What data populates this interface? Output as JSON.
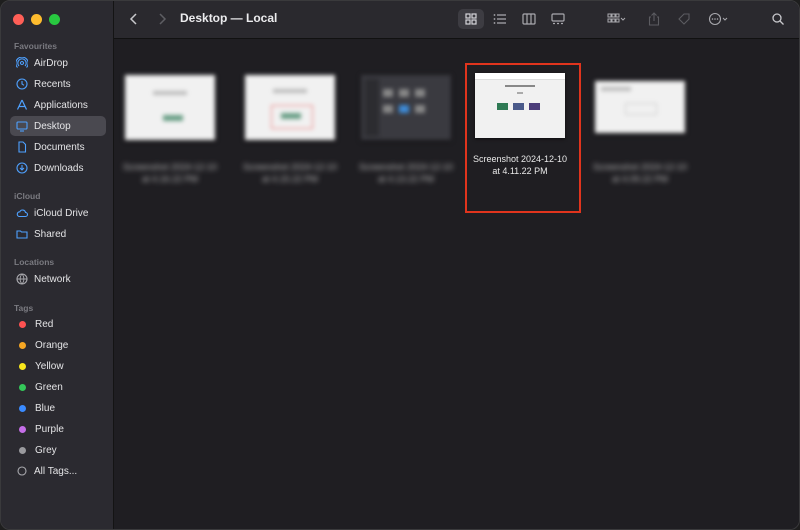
{
  "window": {
    "title": "Desktop — Local"
  },
  "sidebar": {
    "favourites_title": "Favourites",
    "favourites": [
      {
        "label": "AirDrop",
        "icon": "airdrop-icon"
      },
      {
        "label": "Recents",
        "icon": "clock-icon"
      },
      {
        "label": "Applications",
        "icon": "applications-icon"
      },
      {
        "label": "Desktop",
        "icon": "desktop-icon",
        "selected": true
      },
      {
        "label": "Documents",
        "icon": "document-icon"
      },
      {
        "label": "Downloads",
        "icon": "download-icon"
      }
    ],
    "icloud_title": "iCloud",
    "icloud": [
      {
        "label": "iCloud Drive",
        "icon": "cloud-icon"
      },
      {
        "label": "Shared",
        "icon": "shared-folder-icon"
      }
    ],
    "locations_title": "Locations",
    "locations": [
      {
        "label": "Network",
        "icon": "network-icon"
      }
    ],
    "tags_title": "Tags",
    "tags": [
      {
        "label": "Red",
        "color": "#ff5252"
      },
      {
        "label": "Orange",
        "color": "#f5a623"
      },
      {
        "label": "Yellow",
        "color": "#f8e71c"
      },
      {
        "label": "Green",
        "color": "#34c759"
      },
      {
        "label": "Blue",
        "color": "#3a8bff"
      },
      {
        "label": "Purple",
        "color": "#c56ee8"
      },
      {
        "label": "Grey",
        "color": "#9a9a9e"
      },
      {
        "label": "All Tags...",
        "icon": "all-tags-icon"
      }
    ]
  },
  "files": [
    {
      "name_line1": "Screenshot 2024-12-10",
      "name_line2": "at 4.16.22 PM",
      "blurred": true
    },
    {
      "name_line1": "Screenshot 2024-12-10",
      "name_line2": "at 4.15.22 PM",
      "blurred": true
    },
    {
      "name_line1": "Screenshot 2024-12-10",
      "name_line2": "at 4.13.22 PM",
      "blurred": true
    },
    {
      "name_line1": "Screenshot 2024-12-10",
      "name_line2": "at 4.11.22 PM",
      "blurred": false,
      "highlighted": true
    },
    {
      "name_line1": "Screenshot 2024-12-10",
      "name_line2": "at 4.09.22 PM",
      "blurred": true
    }
  ],
  "colors": {
    "highlight": "#e0341d",
    "accent": "#4ea1ff"
  }
}
